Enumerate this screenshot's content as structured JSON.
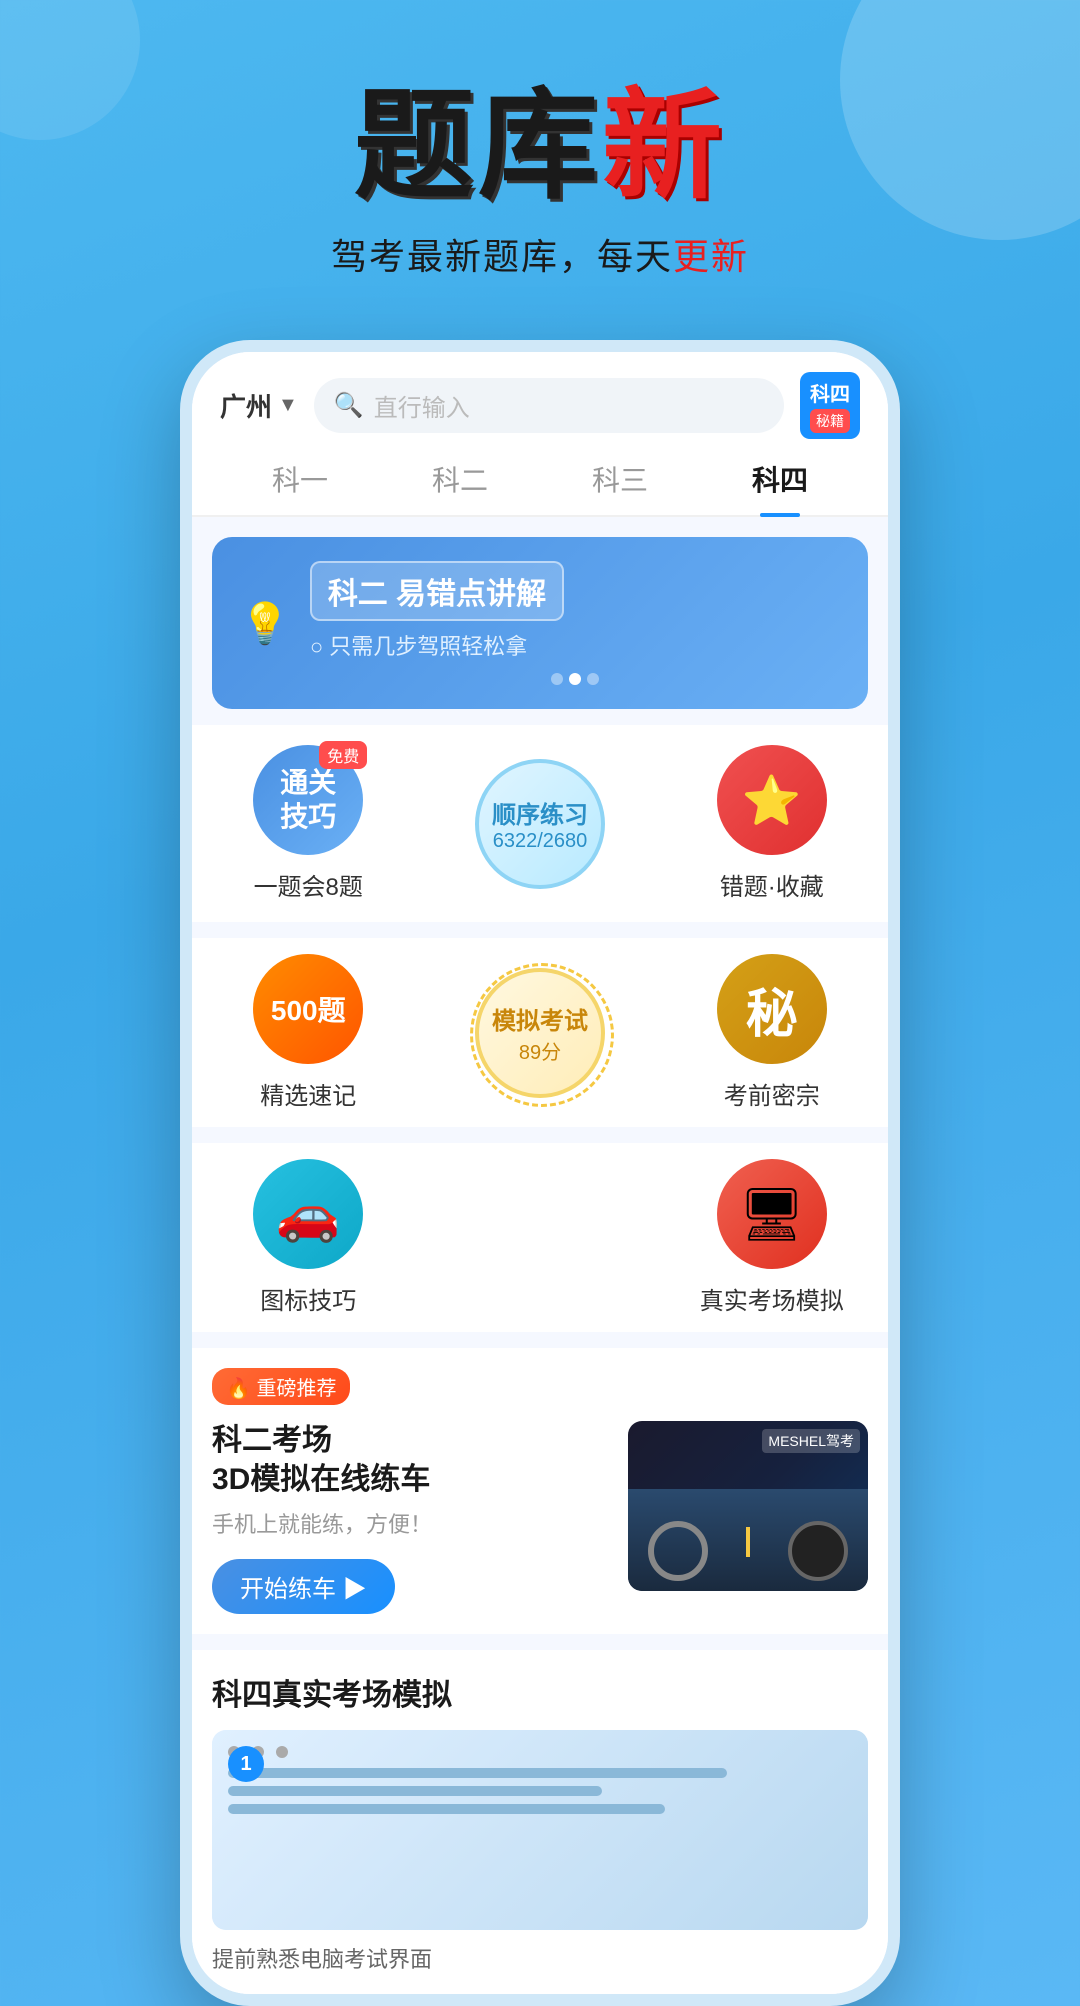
{
  "hero": {
    "title_black": "题库",
    "title_red": "新",
    "subtitle": "驾考最新题库，每天",
    "subtitle_red": "更新"
  },
  "phone": {
    "city": "广州",
    "search_placeholder": "直行输入",
    "ke4_label": "科四",
    "ke4_sub": "秘籍",
    "tabs": [
      {
        "label": "科一",
        "active": false
      },
      {
        "label": "科二",
        "active": false
      },
      {
        "label": "科三",
        "active": false
      },
      {
        "label": "科四",
        "active": true
      }
    ],
    "banner": {
      "title": "科二 易错点讲解",
      "subtitle": "只需几步驾照轻松拿"
    },
    "grid_row1": {
      "item1_label": "一题会8题",
      "item1_title": "通关\n技巧",
      "item1_badge": "免费",
      "item2_label": "顺序练习",
      "item2_count": "6322/2680",
      "item3_label": "错题·收藏"
    },
    "grid_row2": {
      "item1_label": "精选速记",
      "item1_text": "500题",
      "item2_label": "模拟考试",
      "item2_score": "89分",
      "item3_label": "考前密宗",
      "item3_text": "秘"
    },
    "grid_row3": {
      "item1_label": "图标技巧",
      "item3_label": "真实考场模拟"
    },
    "recommend": {
      "tag": "🔥 重磅推荐",
      "title1": "科二考场",
      "title2": "3D模拟在线练车",
      "subtitle": "手机上就能练，方便！",
      "btn": "开始练车 ▶",
      "image_label": "MESHEL驾考"
    },
    "section4": {
      "title": "科四真实考场模拟",
      "step": "1",
      "desc": "提前熟悉电脑考试界面"
    }
  }
}
